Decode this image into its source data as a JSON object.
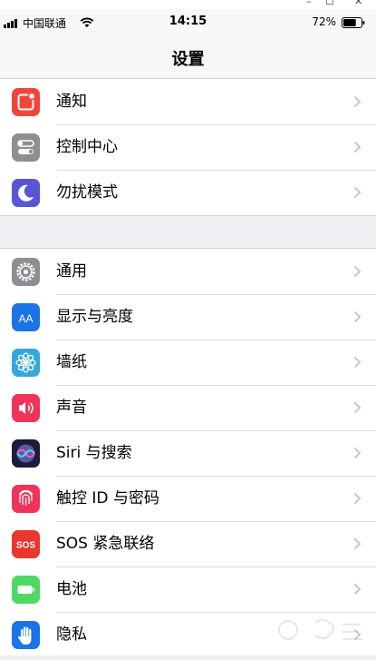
{
  "status_bar": {
    "carrier": "中国联通",
    "time": "14:15",
    "battery_percent": "72%",
    "battery_level": 0.72,
    "signal_icon": "signal-bars-icon",
    "wifi_icon": "wifi-icon",
    "battery_icon": "battery-icon"
  },
  "nav": {
    "title": "设置"
  },
  "groups": [
    {
      "items": [
        {
          "label": "通知",
          "icon": "notifications-icon",
          "color": "#f0453a"
        },
        {
          "label": "控制中心",
          "icon": "control-center-icon",
          "color": "#8e8e93"
        },
        {
          "label": "勿扰模式",
          "icon": "moon-icon",
          "color": "#5856d6"
        }
      ]
    },
    {
      "items": [
        {
          "label": "通用",
          "icon": "gear-icon",
          "color": "#8e8e93"
        },
        {
          "label": "显示与亮度",
          "icon": "display-brightness-icon",
          "color": "#1a73e8"
        },
        {
          "label": "墙纸",
          "icon": "wallpaper-flower-icon",
          "color": "#35a7d9"
        },
        {
          "label": "声音",
          "icon": "speaker-icon",
          "color": "#f0335a"
        },
        {
          "label": "Siri 与搜索",
          "icon": "siri-icon",
          "color": "#1c1c3a"
        },
        {
          "label": "触控 ID 与密码",
          "icon": "fingerprint-icon",
          "color": "#f0335a"
        },
        {
          "label": "SOS 紧急联络",
          "icon": "sos-icon",
          "color": "#e8382e"
        },
        {
          "label": "电池",
          "icon": "battery-icon",
          "color": "#4cd964"
        },
        {
          "label": "隐私",
          "icon": "hand-icon",
          "color": "#1a73e8"
        }
      ]
    }
  ],
  "icon_texts": {
    "aa": "AA",
    "sos": "SOS"
  }
}
